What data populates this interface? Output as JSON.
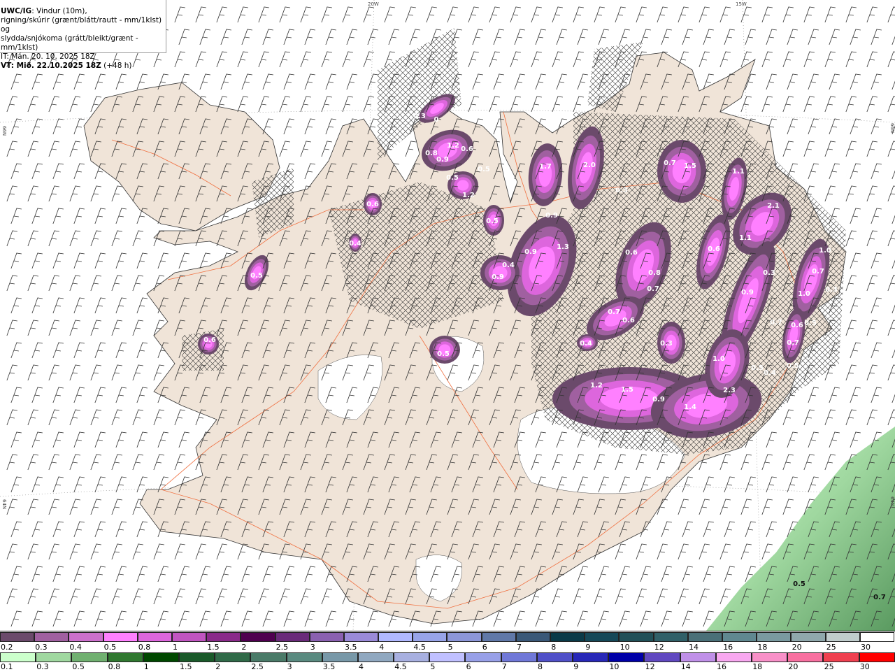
{
  "header": {
    "model": "UWC/IG",
    "line1": ": Vindur (10m),",
    "line2": "rigning/skúrir (grænt/blátt/rautt - mm/1klst) og",
    "line3": "slydda/snjókoma (grátt/bleikt/grænt - mm/1klst)",
    "issue_time": "IT: Mán. 20. 10. 2025 18Z",
    "valid_label": "VT: Mið. 22.10.2025 18Z",
    "lead": " (+48 h)"
  },
  "axes": {
    "lon_labels": [
      "20W",
      "15W"
    ],
    "lat_labels": [
      "66N",
      "64N"
    ]
  },
  "map": {
    "land_color": "#f0e4d8",
    "road_color": "#f07040",
    "glacier_color": "#ffffff",
    "sea_color": "#ffffff",
    "precip_labels": [
      "0.3",
      "0",
      "0.8",
      "1.2",
      "0.9",
      "0.6",
      "0.5",
      "0.5",
      "1.2",
      "0.6",
      "0.4",
      "0.5",
      "0.5",
      "0.6",
      "0.5",
      "1.7",
      "2.0",
      "0.3",
      "0.9",
      "0.9",
      "1.3",
      "0.9",
      "0.4",
      "0.7",
      "1.5",
      "1.1",
      "2.1",
      "1.1",
      "0.6",
      "0.6",
      "0.8",
      "0.7",
      "0.7",
      "0.6",
      "0.4",
      "0.3",
      "0.9",
      "0.3",
      "1.0",
      "0.7",
      "0.3",
      "1.0",
      "0.7",
      "0.6",
      "0.5",
      "0.7",
      "1.0",
      "0.5",
      "0.4",
      "0.5",
      "1.2",
      "1.5",
      "0.9",
      "1.4",
      "2.3",
      "0.5",
      "0.7"
    ]
  },
  "legend_snow": {
    "labels": [
      "0.2",
      "0.3",
      "0.4",
      "0.5",
      "0.8",
      "1",
      "1.5",
      "2",
      "2.5",
      "3",
      "3.5",
      "4",
      "4.5",
      "5",
      "6",
      "7",
      "8",
      "9",
      "10",
      "12",
      "14",
      "16",
      "18",
      "20",
      "25",
      "30"
    ],
    "colors": [
      "#6b4a6b",
      "#a060a0",
      "#cc70cc",
      "#ff80ff",
      "#dd66dd",
      "#c055c0",
      "#8a2a8a",
      "#500050",
      "#6a2a7a",
      "#8a60b0",
      "#9a8ad8",
      "#b0b8ff",
      "#98a4e8",
      "#8c96d8",
      "#6078a8",
      "#3a5878",
      "#0a3a48",
      "#154858",
      "#205058",
      "#306068",
      "#4a7078",
      "#608890",
      "#7a9aa0",
      "#90a8ac",
      "#c0cccc",
      "#ffffff"
    ]
  },
  "legend_rain": {
    "labels": [
      "0.1",
      "0.3",
      "0.5",
      "0.8",
      "1",
      "1.5",
      "2",
      "2.5",
      "3",
      "3.5",
      "4",
      "4.5",
      "5",
      "6",
      "7",
      "8",
      "9",
      "10",
      "12",
      "14",
      "16",
      "18",
      "20",
      "25",
      "30"
    ],
    "colors": [
      "#ccffcc",
      "#a0d8a0",
      "#70b070",
      "#307830",
      "#004800",
      "#1a5a2a",
      "#306a48",
      "#4a7a68",
      "#5a8a80",
      "#7898a8",
      "#90a8c0",
      "#a8b0e0",
      "#c0c0ff",
      "#98a0e8",
      "#7078d8",
      "#5050c8",
      "#2828b8",
      "#0000a8",
      "#6048c0",
      "#c090e8",
      "#f8a8f0",
      "#f890c8",
      "#f870a0",
      "#f04050",
      "#ff0000"
    ]
  }
}
